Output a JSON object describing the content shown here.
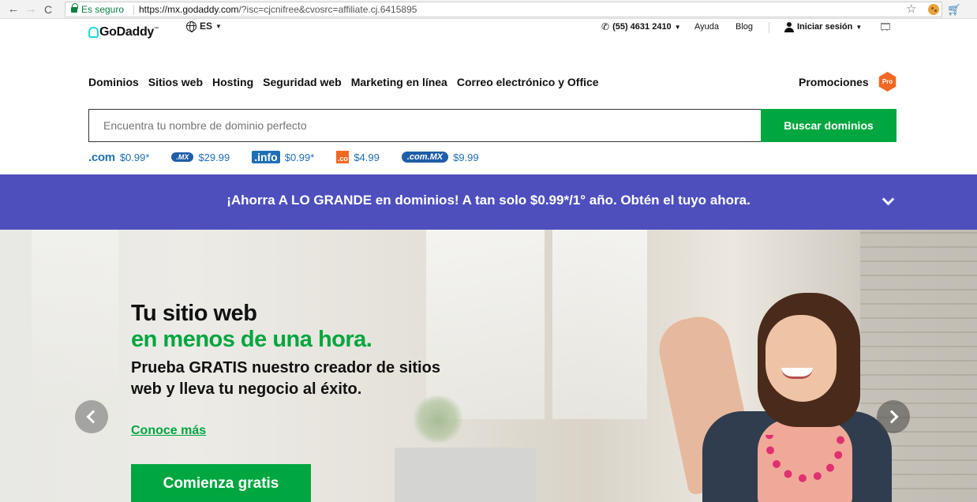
{
  "browser": {
    "secure_label": "Es seguro",
    "url_host": "https://mx.godaddy.com",
    "url_rest": "/?isc=cjcnifree&cvosrc=affiliate.cj.6415895"
  },
  "header": {
    "logo_text": "GoDaddy",
    "logo_tm": "™",
    "language": "ES",
    "phone": "(55) 4631 2410",
    "help": "Ayuda",
    "blog": "Blog",
    "signin": "Iniciar sesión"
  },
  "nav": {
    "items": [
      "Dominios",
      "Sitios web",
      "Hosting",
      "Seguridad web",
      "Marketing en línea",
      "Correo electrónico y Office"
    ],
    "promotions": "Promociones",
    "pro_badge": "Pro"
  },
  "search": {
    "placeholder": "Encuentra tu nombre de dominio perfecto",
    "button": "Buscar dominios"
  },
  "tlds": [
    {
      "badge": ".com",
      "price": "$0.99*"
    },
    {
      "badge": ".MX",
      "price": "$29.99"
    },
    {
      "badge": ".info",
      "price": "$0.99*"
    },
    {
      "badge": ".co",
      "price": "$4.99"
    },
    {
      "badge": ".com.MX",
      "price": "$9.99"
    }
  ],
  "banner": {
    "text": "¡Ahorra A LO GRANDE en dominios! A tan solo $0.99*/1° año. Obtén el tuyo ahora."
  },
  "hero": {
    "title_line1": "Tu sitio web",
    "title_line2": "en menos de una hora.",
    "subtitle": "Prueba GRATIS nuestro creador de sitios web y lleva tu negocio al éxito.",
    "link": "Conoce más",
    "cta": "Comienza gratis"
  },
  "colors": {
    "brand_green": "#00a63f",
    "banner_purple": "#4e4fbd",
    "promo_orange": "#f26822",
    "tld_blue": "#1f6fb5"
  }
}
